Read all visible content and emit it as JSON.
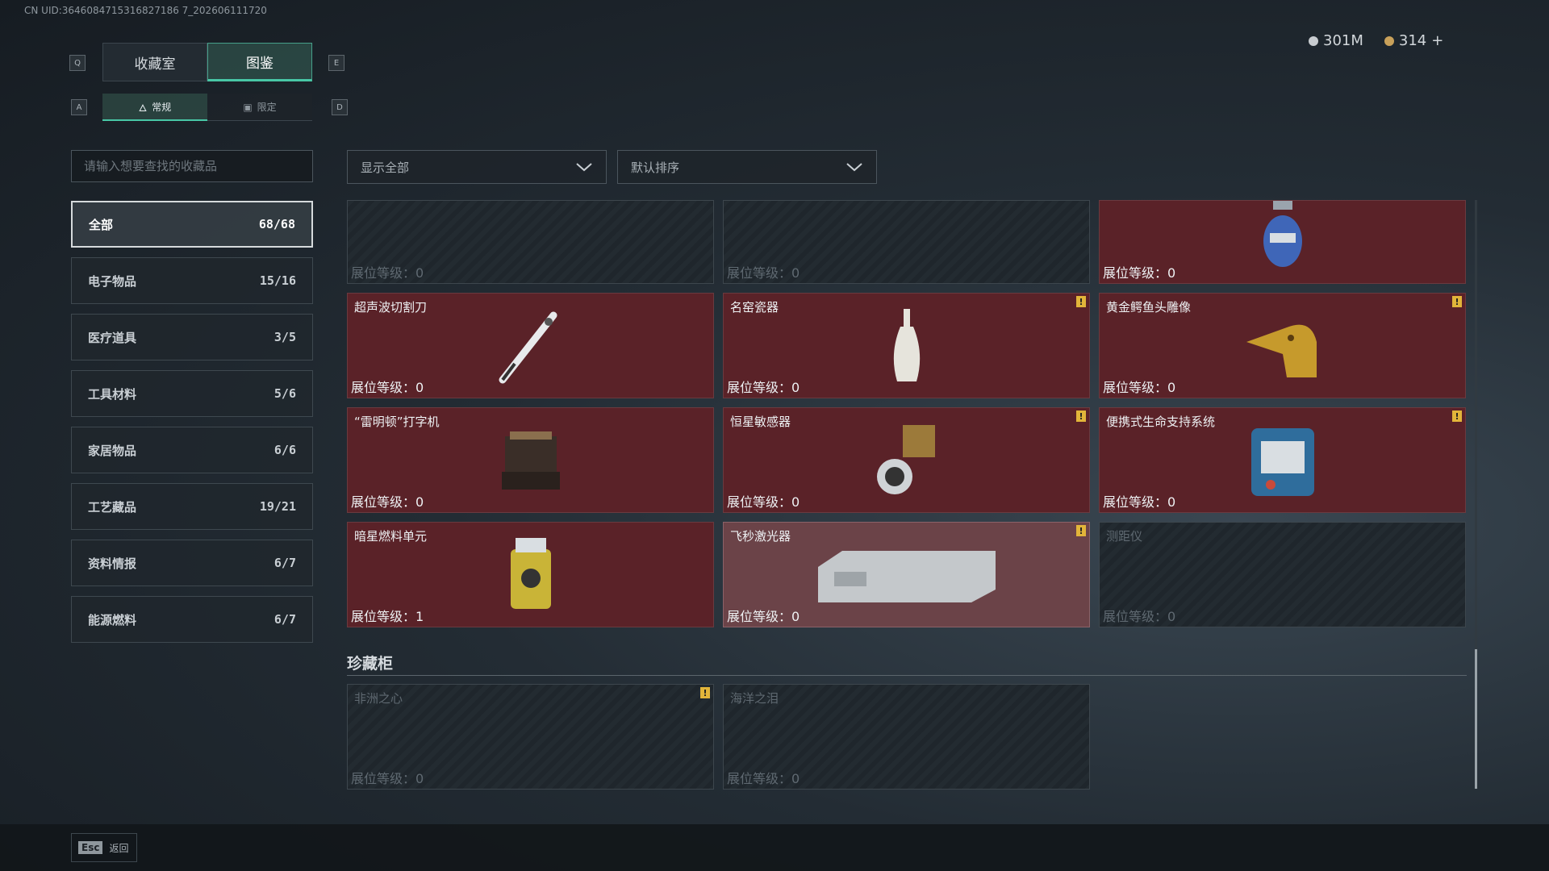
{
  "uid": "CN UID:3646084715316827186 7_202606111720",
  "tabs": {
    "left_key": "Q",
    "right_key": "E",
    "items": [
      {
        "label": "收藏室"
      },
      {
        "label": "图鉴"
      }
    ]
  },
  "subtabs": {
    "left_key": "A",
    "right_key": "D",
    "items": [
      {
        "label": "常规"
      },
      {
        "label": "限定"
      }
    ]
  },
  "currency": {
    "silver": "301M",
    "gold": "314",
    "add": "+"
  },
  "search": {
    "placeholder": "请输入想要查找的收藏品"
  },
  "filters": {
    "show": "显示全部",
    "sort": "默认排序"
  },
  "categories": [
    {
      "label": "全部",
      "count": "68/68"
    },
    {
      "label": "电子物品",
      "count": "15/16"
    },
    {
      "label": "医疗道具",
      "count": "3/5"
    },
    {
      "label": "工具材料",
      "count": "5/6"
    },
    {
      "label": "家居物品",
      "count": "6/6"
    },
    {
      "label": "工艺藏品",
      "count": "19/21"
    },
    {
      "label": "资料情报",
      "count": "6/7"
    },
    {
      "label": "能源燃料",
      "count": "6/7"
    }
  ],
  "grid": [
    {
      "name": "",
      "level": "展位等级：0"
    },
    {
      "name": "",
      "level": "展位等级：0"
    },
    {
      "name": "",
      "level": "展位等级：0"
    },
    {
      "name": "超声波切割刀",
      "level": "展位等级：0"
    },
    {
      "name": "名窑瓷器",
      "level": "展位等级：0"
    },
    {
      "name": "黄金鳄鱼头雕像",
      "level": "展位等级：0"
    },
    {
      "name": "“雷明顿”打字机",
      "level": "展位等级：0"
    },
    {
      "name": "恒星敏感器",
      "level": "展位等级：0"
    },
    {
      "name": "便携式生命支持系统",
      "level": "展位等级：0"
    },
    {
      "name": "暗星燃料单元",
      "level": "展位等级：1"
    },
    {
      "name": "飞秒激光器",
      "level": "展位等级：0"
    },
    {
      "name": "测距仪",
      "level": "展位等级：0"
    }
  ],
  "cabinet": {
    "title": "珍藏柜",
    "items": [
      {
        "name": "非洲之心",
        "level": "展位等级：0"
      },
      {
        "name": "海洋之泪",
        "level": "展位等级：0"
      }
    ]
  },
  "warn_glyph": "!",
  "footer": {
    "key": "Esc",
    "label": "返回"
  },
  "colors": {
    "accent": "#48c7a6",
    "card_owned": "#5a2228",
    "warn": "#e2b53a"
  }
}
